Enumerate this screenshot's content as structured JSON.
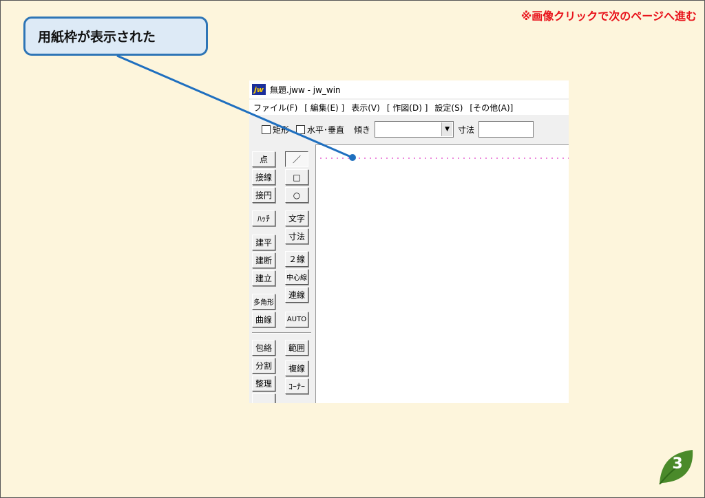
{
  "nav_hint": "※画像クリックで次のページへ進む",
  "callout": {
    "text": "用紙枠が表示された"
  },
  "app": {
    "logo": "jw",
    "title": "無題.jww - jw_win",
    "menu": [
      "ファイル(F)",
      "[ 編集(E) ]",
      "表示(V)",
      "[ 作図(D) ]",
      "設定(S)",
      "[その他(A)]"
    ],
    "toolbar": {
      "rect_label": "矩形",
      "hv_label": "水平･垂直",
      "tilt_label": "傾き",
      "dim_label": "寸法"
    },
    "tools_left": [
      "点",
      "接線",
      "接円",
      "ﾊｯﾁ",
      "建平",
      "建断",
      "建立",
      "多角形",
      "曲線",
      "包絡",
      "分割",
      "整理"
    ],
    "tools_right": [
      "／",
      "□",
      "○",
      "文字",
      "寸法",
      "２線",
      "中心線",
      "連線",
      "AUTO",
      "範囲",
      "複線",
      "ｺｰﾅｰ"
    ]
  },
  "page_number": "3",
  "colors": {
    "nav_hint": "#e8121a",
    "callout_border": "#2e75b6",
    "callout_bg": "#ddeaf6",
    "paper_frame": "#e040c8",
    "badge": "#4a8a2a"
  }
}
